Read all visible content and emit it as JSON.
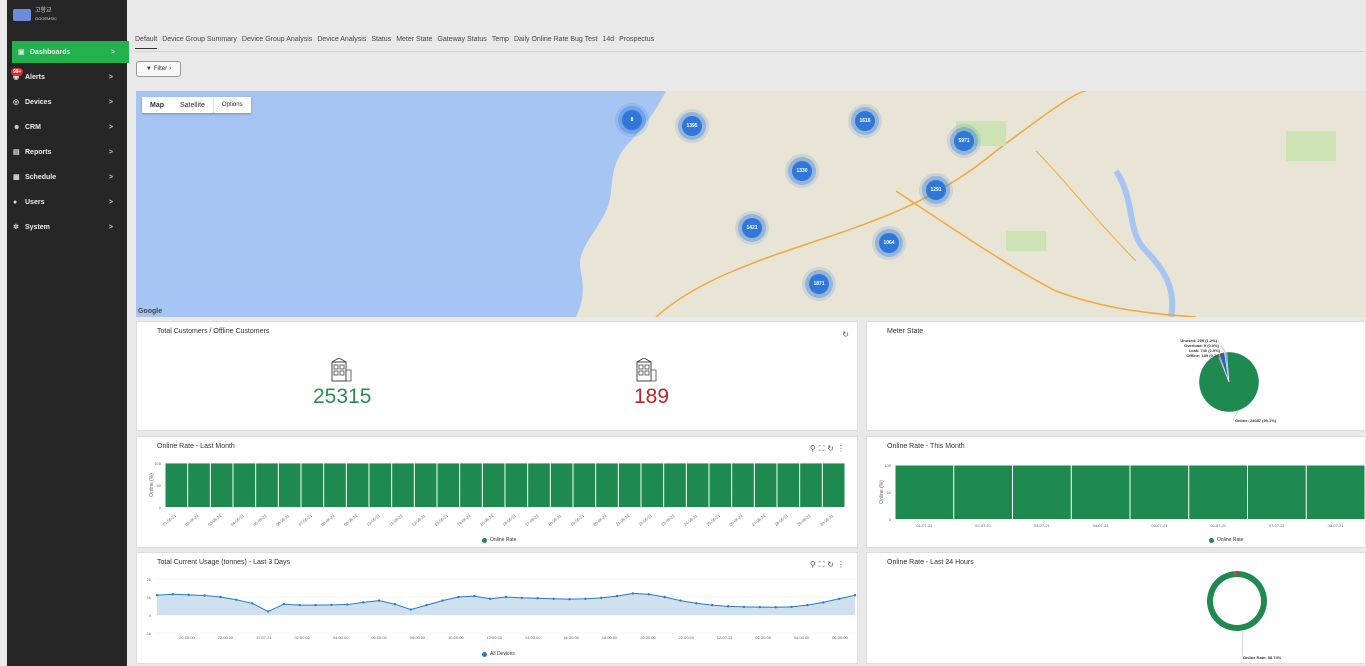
{
  "brand": {
    "name": "고향교",
    "sub": "GOOEMSIC"
  },
  "sidebar": {
    "items": [
      {
        "label": "Dashboards",
        "icon": "dashboard-icon",
        "active": true
      },
      {
        "label": "Alerts",
        "icon": "alert-icon",
        "badge": "99+"
      },
      {
        "label": "Devices",
        "icon": "device-icon"
      },
      {
        "label": "CRM",
        "icon": "people-icon"
      },
      {
        "label": "Reports",
        "icon": "report-icon"
      },
      {
        "label": "Schedule",
        "icon": "calendar-icon"
      },
      {
        "label": "Users",
        "icon": "user-icon"
      },
      {
        "label": "System",
        "icon": "gear-icon"
      }
    ],
    "chevron": ">"
  },
  "tabs": [
    "Default",
    "Device Group Summary",
    "Device Group Analysis",
    "Device Analysis",
    "Status",
    "Meter State",
    "Gateway Status",
    "Temp",
    "Daily Online Rate Bug Test",
    "14d",
    "Prospectus"
  ],
  "filter": {
    "label": "Filter",
    "chevron": "›"
  },
  "map": {
    "controls": {
      "map": "Map",
      "satellite": "Satellite",
      "options": "Options"
    },
    "attribution": "Google",
    "clusters": [
      "8",
      "1395",
      "1616",
      "5971",
      "1330",
      "1291",
      "1421",
      "1064",
      "1871"
    ],
    "colors": {
      "water": "#a4c2f4",
      "land": "#e5e2d8",
      "cluster": "#2f77d9",
      "road": "#f2a93b"
    }
  },
  "panels": {
    "customers": {
      "title": "Total Customers / Offline Customers",
      "total": "25315",
      "offline": "189",
      "total_color": "#2e8b4f",
      "offline_color": "#b5282c"
    },
    "meter_state": {
      "title": "Meter State"
    },
    "online_last_month": {
      "title": "Online Rate - Last Month",
      "ylabel": "Online (%)",
      "legend": "Online Rate"
    },
    "online_this_month": {
      "title": "Online Rate - This Month",
      "ylabel": "Online (%)",
      "legend": "Online Rate"
    },
    "usage": {
      "title": "Total Current Usage (tonnes) - Last 3 Days",
      "legend": "All Devices"
    },
    "online_24h": {
      "title": "Online Rate - Last 24 Hours"
    }
  },
  "chart_data": [
    {
      "type": "pie",
      "title": "Meter State",
      "slices": [
        {
          "label": "Online",
          "value": 24087,
          "text": "Online: 24087 (95.1%)",
          "color": "#1e8a4f"
        },
        {
          "label": "Offline",
          "value": 189,
          "text": "Offline: 189 (0.7%)",
          "color": "#d33a3a"
        },
        {
          "label": "Leak",
          "value": 740,
          "text": "Leak: 740 (2.9%)",
          "color": "#2a62b8"
        },
        {
          "label": "Overload",
          "value": 0,
          "text": "Overload: 0 (0.0%)",
          "color": "#888888"
        },
        {
          "label": "Unused",
          "value": 299,
          "text": "Unused: 299 (1.2%)",
          "color": "#6aa3e0"
        }
      ]
    },
    {
      "type": "bar",
      "title": "Online Rate - Last Month",
      "ylabel": "Online (%)",
      "ylim": [
        0,
        100
      ],
      "yticks": [
        "100",
        "50",
        "0"
      ],
      "categories": [
        "01-06-21",
        "02-06-21",
        "03-06-21",
        "04-06-21",
        "05-06-21",
        "06-06-21",
        "07-06-21",
        "08-06-21",
        "09-06-21",
        "10-06-21",
        "11-06-21",
        "12-06-21",
        "13-06-21",
        "14-06-21",
        "15-06-21",
        "16-06-21",
        "17-06-21",
        "18-06-21",
        "19-06-21",
        "20-06-21",
        "21-06-21",
        "22-06-21",
        "23-06-21",
        "24-06-21",
        "25-06-21",
        "26-06-21",
        "27-06-21",
        "28-06-21",
        "29-06-21",
        "30-06-21"
      ],
      "values": [
        99,
        99,
        99,
        99,
        99,
        99,
        99,
        99,
        99,
        99,
        99,
        99,
        99,
        99,
        99,
        99,
        99,
        99,
        99,
        99,
        99,
        99,
        99,
        99,
        99,
        99,
        99,
        99,
        99,
        99
      ],
      "series": [
        {
          "name": "Online Rate"
        }
      ],
      "color": "#1e8a4f"
    },
    {
      "type": "bar",
      "title": "Online Rate - This Month",
      "ylabel": "Online (%)",
      "ylim": [
        0,
        100
      ],
      "yticks": [
        "100",
        "50",
        "0"
      ],
      "categories": [
        "01-07-21",
        "02-07-21",
        "03-07-21",
        "04-07-21",
        "05-07-21",
        "06-07-21",
        "07-07-21",
        "08-07-21"
      ],
      "values": [
        99,
        99,
        99,
        99,
        99,
        99,
        99,
        99
      ],
      "series": [
        {
          "name": "Online Rate"
        }
      ],
      "color": "#1e8a4f"
    },
    {
      "type": "area",
      "title": "Total Current Usage (tonnes) - Last 3 Days",
      "ylim": [
        -1000,
        2000
      ],
      "yticks": [
        "2k",
        "1k",
        "0",
        "-1k"
      ],
      "xticks": [
        "20:00:00",
        "22:00:00",
        "11-07-21",
        "02:00:00",
        "04:00:00",
        "06:00:00",
        "08:00:00",
        "10:00:00",
        "12:00:00",
        "14:00:00",
        "16:00:00",
        "18:00:00",
        "20:00:00",
        "22:00:00",
        "12-07-21",
        "02:00:00",
        "04:00:00",
        "06:00:00"
      ],
      "values": [
        1100,
        1150,
        1120,
        1080,
        1000,
        850,
        650,
        200,
        600,
        550,
        550,
        560,
        580,
        700,
        800,
        600,
        300,
        550,
        800,
        1000,
        1050,
        900,
        1000,
        950,
        930,
        900,
        880,
        900,
        950,
        1050,
        1200,
        1150,
        1000,
        800,
        650,
        550,
        480,
        450,
        440,
        430,
        450,
        550,
        700,
        900,
        1100
      ],
      "series": [
        {
          "name": "All Devices"
        }
      ],
      "color": "#2a7bc8"
    },
    {
      "type": "pie",
      "title": "Online Rate - Last 24 Hours",
      "slices": [
        {
          "label": "Online Rate",
          "value": 98.74,
          "text": "Online Rate: 98.74%",
          "color": "#1e8a4f"
        },
        {
          "label": "Offline",
          "value": 1.26,
          "color": "#d33a3a"
        }
      ]
    }
  ]
}
